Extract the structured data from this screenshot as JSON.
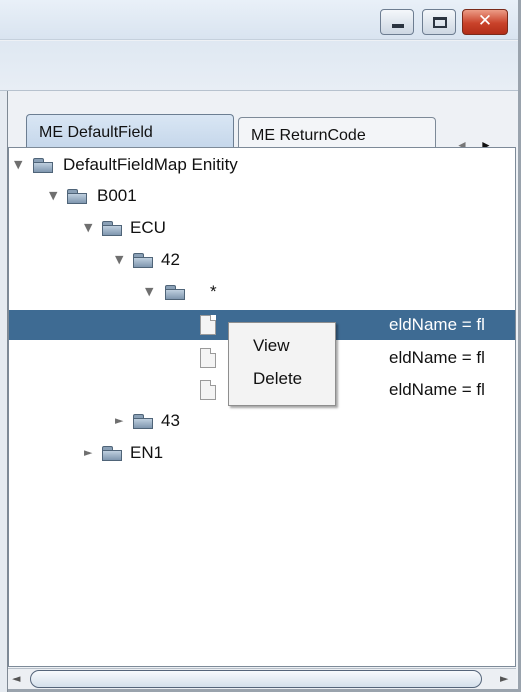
{
  "window": {
    "title_buttons": [
      "minimize-icon",
      "maximize-icon",
      "close-icon"
    ],
    "close_glyph": "✕"
  },
  "tabs": [
    {
      "label": "ME DefaultField",
      "active": true
    },
    {
      "label": "ME ReturnCode",
      "active": false
    }
  ],
  "tab_scroll": {
    "left": "◄",
    "right": "►"
  },
  "tree": {
    "expanded_marker": "▼",
    "collapsed_marker": "►",
    "nodes": [
      {
        "label": "DefaultFieldMap Enitity",
        "type": "folder",
        "expanded": true
      },
      {
        "label": "B001",
        "type": "folder",
        "expanded": true
      },
      {
        "label": "ECU",
        "type": "folder",
        "expanded": true
      },
      {
        "label": "42",
        "type": "folder",
        "expanded": true
      },
      {
        "label": "*",
        "type": "folder",
        "expanded": true
      },
      {
        "label": "eldName = fl",
        "type": "leaf",
        "selected": true
      },
      {
        "label": "eldName = fl",
        "type": "leaf",
        "selected": false
      },
      {
        "label": "eldName = fl",
        "type": "leaf",
        "selected": false
      },
      {
        "label": "43",
        "type": "folder",
        "expanded": false
      },
      {
        "label": "EN1",
        "type": "folder",
        "expanded": false
      }
    ]
  },
  "context_menu": {
    "items": [
      "View",
      "Delete"
    ]
  },
  "hscroll": {
    "left": "◄",
    "right": "►"
  },
  "colors": {
    "selection": "#3e6b93",
    "close_button": "#c9422a"
  }
}
